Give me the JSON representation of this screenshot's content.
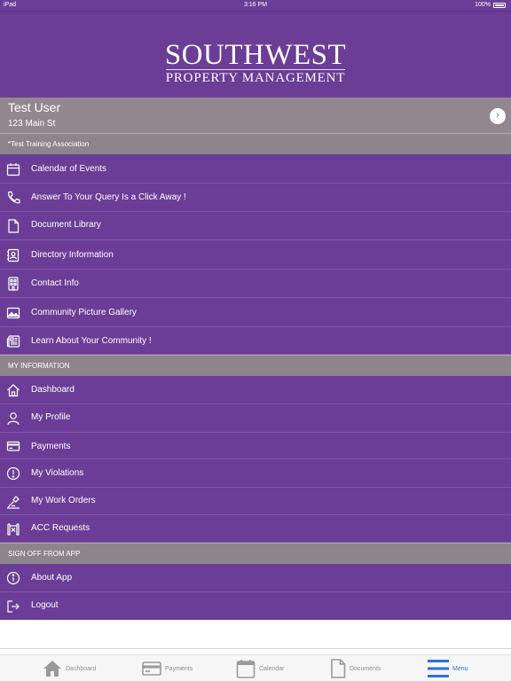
{
  "status_bar": {
    "device": "iPad",
    "time": "3:16 PM",
    "battery": "100%"
  },
  "brand": {
    "line1": "SOUTHWEST",
    "line2": "PROPERTY MANAGEMENT"
  },
  "user": {
    "name": "Test User",
    "address": "123 Main St"
  },
  "association": "*Test Training Association",
  "menu_main": [
    {
      "label": "Calendar of Events",
      "icon": "calendar-icon"
    },
    {
      "label": "Answer To Your Query Is a Click Away !",
      "icon": "phone-icon"
    },
    {
      "label": "Document Library",
      "icon": "document-icon"
    },
    {
      "label": "Directory Information",
      "icon": "contact-card-icon"
    },
    {
      "label": "Contact Info",
      "icon": "building-icon"
    },
    {
      "label": "Community Picture Gallery",
      "icon": "image-icon"
    },
    {
      "label": "Learn About Your Community !",
      "icon": "newspaper-icon"
    }
  ],
  "my_info_header": "MY INFORMATION",
  "menu_info": [
    {
      "label": "Dashboard",
      "icon": "home-icon"
    },
    {
      "label": "My Profile",
      "icon": "person-icon"
    },
    {
      "label": "Payments",
      "icon": "card-icon"
    },
    {
      "label": "My Violations",
      "icon": "alert-icon"
    },
    {
      "label": "My Work Orders",
      "icon": "wrench-icon"
    },
    {
      "label": "ACC Requests",
      "icon": "blueprint-icon"
    }
  ],
  "signoff_header": "SIGN OFF FROM APP",
  "menu_signoff": [
    {
      "label": "About App",
      "icon": "info-icon"
    },
    {
      "label": "Logout",
      "icon": "logout-icon"
    }
  ],
  "tabs": [
    {
      "label": "Dashboard",
      "icon": "home-icon"
    },
    {
      "label": "Payments",
      "icon": "card-icon"
    },
    {
      "label": "Calendar",
      "icon": "calendar-icon"
    },
    {
      "label": "Documents",
      "icon": "document-icon"
    },
    {
      "label": "Menu",
      "icon": "hamburger-icon",
      "active": true
    }
  ],
  "colors": {
    "primary": "#6b3d96",
    "section": "#8c858c",
    "user_bar": "#94868e",
    "active_tab": "#2f6fd9"
  }
}
